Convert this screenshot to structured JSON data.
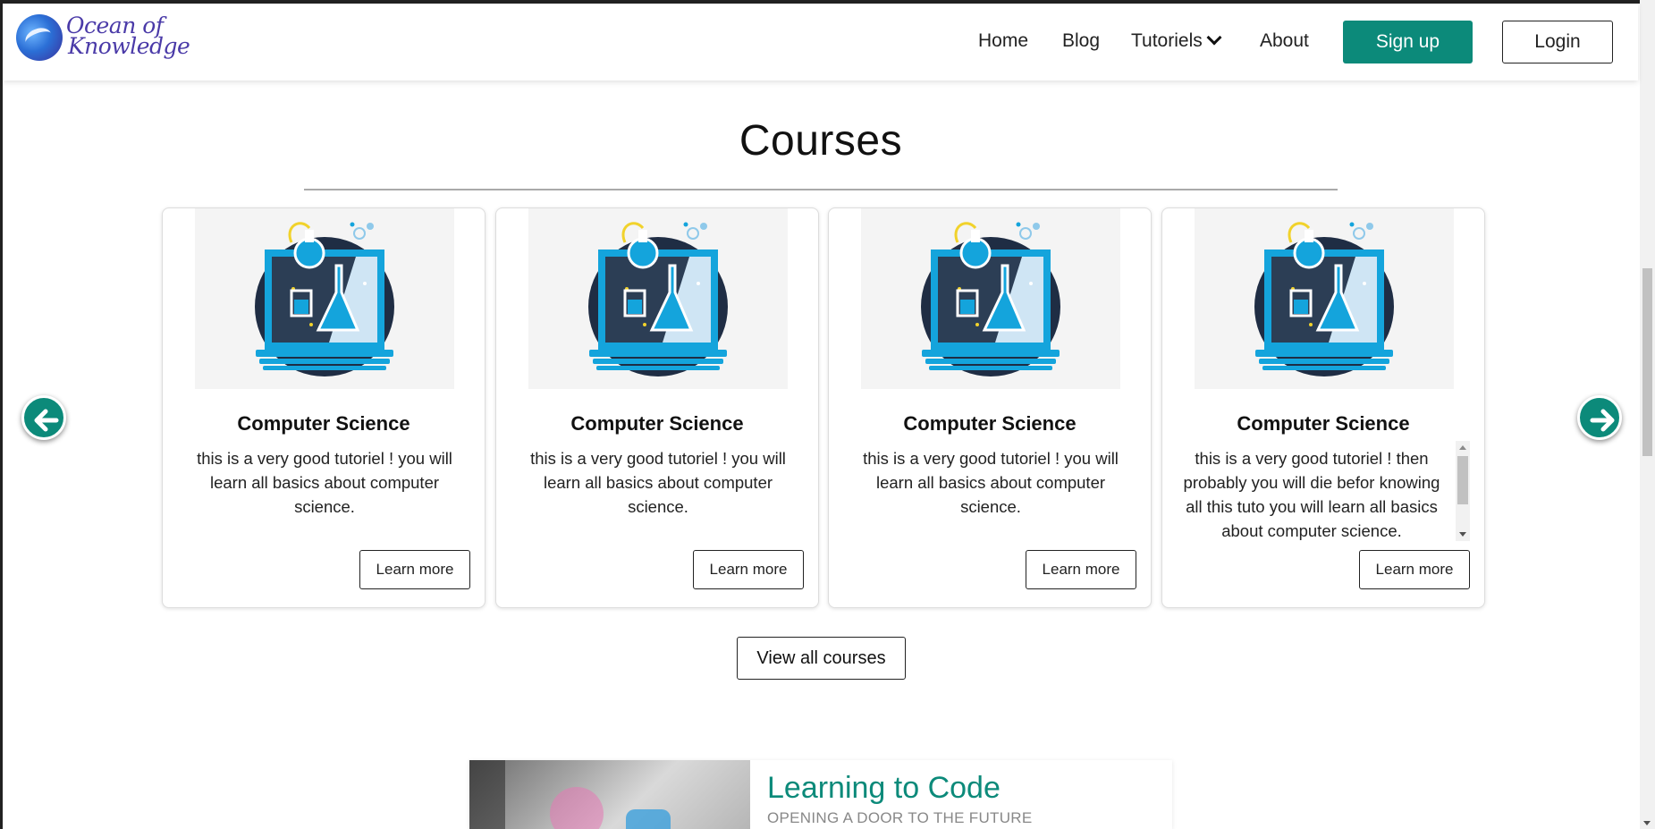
{
  "brand": {
    "line1": "Ocean of",
    "line2": "Knowledge"
  },
  "nav": {
    "home": "Home",
    "blog": "Blog",
    "tutoriels": "Tutoriels",
    "about": "About",
    "signup": "Sign up",
    "login": "Login"
  },
  "courses": {
    "title": "Courses",
    "cards": [
      {
        "title": "Computer Science",
        "description": "this is a very good tutoriel ! you will learn all basics about computer science.",
        "button": "Learn more"
      },
      {
        "title": "Computer Science",
        "description": "this is a very good tutoriel ! you will learn all basics about computer science.",
        "button": "Learn more"
      },
      {
        "title": "Computer Science",
        "description": "this is a very good tutoriel ! you will learn all basics about computer science.",
        "button": "Learn more"
      },
      {
        "title": "Computer Science",
        "description": "this is a very good tutoriel ! then probably you will die befor knowing all this tuto you will learn all basics about computer science.",
        "button": "Learn more"
      }
    ],
    "view_all": "View all courses"
  },
  "learning": {
    "title": "Learning to Code",
    "subtitle": "OPENING A DOOR TO THE FUTURE"
  },
  "icons": {
    "prev": "arrow-left-icon",
    "next": "arrow-right-icon",
    "dropdown": "chevron-down-icon",
    "course_image": "computer-science-lab-icon"
  },
  "colors": {
    "accent": "#0c8a7a",
    "brand": "#4a3aa8"
  }
}
